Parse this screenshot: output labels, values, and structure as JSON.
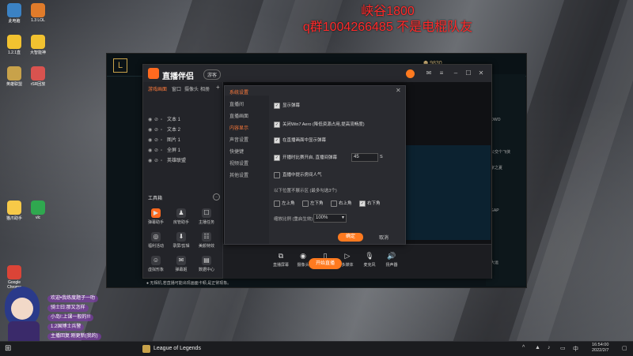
{
  "overlay": {
    "line1": "峡谷1800",
    "line2": "q群1004266485  不是电棍队友"
  },
  "desktop_icons": [
    {
      "label": "此电脑",
      "color": "#3b82c4"
    },
    {
      "label": "1.3 LOL",
      "color": "#e07b2a"
    },
    {
      "label": "1.2.1直",
      "color": "#f2c230"
    },
    {
      "label": "大智能神",
      "color": "#f2c230"
    },
    {
      "label": "英雄联盟",
      "color": "#c8a24a"
    },
    {
      "label": "rSR回放",
      "color": "#d9534f"
    },
    {
      "label": "猫爪助手",
      "color": "#f7c948"
    },
    {
      "label": "vlc",
      "color": "#2fa84f"
    },
    {
      "label": "Google Chrome",
      "color": "#db4437"
    }
  ],
  "lol_client": {
    "currency": "9830",
    "right_panel": [
      "OWO",
      "公交个飞侠",
      "家之夏",
      "GAP",
      "大运"
    ]
  },
  "app": {
    "name": "直播伴侣",
    "version": "游客",
    "tabs": [
      "游戏画面",
      "窗口",
      "摄像头",
      "相册"
    ],
    "scenes": [
      "文本 1",
      "文本 2",
      "图片 1",
      "全屏 1",
      "英雄联盟"
    ],
    "tools_title": "工具箱",
    "tools": [
      {
        "label": "弹幕助手",
        "icon": "▶"
      },
      {
        "label": "房管助手",
        "icon": "♟"
      },
      {
        "label": "主播任务",
        "icon": "☐"
      },
      {
        "label": "福利活动",
        "icon": "◎"
      },
      {
        "label": "录屏/剪辑",
        "icon": "⬇"
      },
      {
        "label": "美颜特效",
        "icon": "☷"
      },
      {
        "label": "虚拟形象",
        "icon": "☺"
      },
      {
        "label": "弹幕姬",
        "icon": "✉"
      },
      {
        "label": "数据中心",
        "icon": "▤"
      }
    ],
    "bottom_tools": [
      {
        "label": "直播屏幕",
        "icon": "⧉"
      },
      {
        "label": "摄像头",
        "icon": "◉"
      },
      {
        "label": "手机投屏",
        "icon": "▯"
      },
      {
        "label": "多媒体",
        "icon": "▷"
      },
      {
        "label": "麦克风",
        "icon": "🎙"
      },
      {
        "label": "扬声器",
        "icon": "🔊"
      }
    ],
    "start_label": "开始直播",
    "status": "● 无相机,若直播可能出现画面卡顿,是正常现象。"
  },
  "dialog": {
    "title": "系统设置",
    "nav": [
      "直播间",
      "直播画面",
      "内容显示",
      "声音设置",
      "快捷键",
      "视频设置",
      "其他设置"
    ],
    "active_nav": 2,
    "opt_show_popup": "显示弹幕",
    "opt_close_win7": "关闭Win7 Aero (降低资源占用,提高流畅度)",
    "opt_show_in_preview": "在直播画面中显示弹幕",
    "opt_open_join": "开播时比赛开启, 直播间弹幕",
    "value_input": "45",
    "value_unit": "S",
    "opt_live_prompt": "直播中提示房间人气",
    "position_label": "以下位置不展示区 (最多勾选3个)",
    "positions": [
      {
        "label": "左上角",
        "on": false
      },
      {
        "label": "左下角",
        "on": false
      },
      {
        "label": "右上角",
        "on": false
      },
      {
        "label": "右下角",
        "on": true
      }
    ],
    "zoom_label": "缩放比例 (重启生效)",
    "zoom_value": "100%",
    "confirm": "确定",
    "cancel": "取消"
  },
  "chat": [
    "欢迎•我练度题子一叻",
    "骑士曰:那又怎样",
    "小岛!:上课一般的!!!",
    "1.2国博士兵警",
    "主播回复:刚更新(我的)"
  ],
  "taskbar": {
    "app": "League of Legends",
    "time": "16:54:00",
    "date": "2022/2/7"
  },
  "colors": {
    "accent": "#ff7a1f",
    "overlay_red": "#ff2a2a",
    "chat_purple": "#7a3ca0"
  }
}
